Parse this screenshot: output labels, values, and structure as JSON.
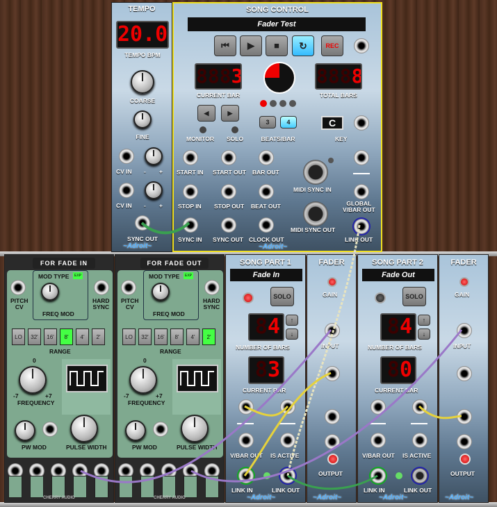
{
  "tempo": {
    "title": "TEMPO",
    "value_ghost": "8",
    "value": "20.0",
    "bpm_label": "TEMPO BPM",
    "coarse": "COARSE",
    "fine": "FINE",
    "cv_in": "CV IN",
    "minus": "-",
    "plus": "+",
    "sync_out": "SYNC OUT",
    "brand": "~Adroit~"
  },
  "song": {
    "title": "SONG CONTROL",
    "song_name": "Fader Test",
    "rec": "REC",
    "current_bar_ghost": "888",
    "current_bar": "3",
    "current_bar_label": "CURRENT BAR",
    "total_bars_ghost": "888",
    "total_bars": "8",
    "total_bars_label": "TOTAL BARS",
    "monitor": "MONITOR",
    "solo": "SOLO",
    "beats3": "3",
    "beats4": "4",
    "beats_label": "BEATS/BAR",
    "key": "C",
    "key_label": "KEY",
    "start_in": "START IN",
    "start_out": "START OUT",
    "bar_out": "BAR OUT",
    "midi_sync_in": "MIDI SYNC IN",
    "stop_in": "STOP IN",
    "stop_out": "STOP OUT",
    "beat_out": "BEAT OUT",
    "global_vbar": "GLOBAL\nV/BAR OUT",
    "sync_in": "SYNC IN",
    "sync_out": "SYNC OUT",
    "clock_out": "CLOCK OUT",
    "midi_sync_out": "MIDI SYNC OUT",
    "link_out": "LINK OUT",
    "brand": "~Adroit~"
  },
  "osc1": {
    "title": "FOR FADE IN",
    "mod_type": "MOD TYPE",
    "exp": "EXP",
    "pitch_cv": "PITCH\nCV",
    "hard_sync": "HARD\nSYNC",
    "freq_mod": "FREQ MOD",
    "ranges": [
      "LO",
      "32'",
      "16'",
      "8'",
      "4'",
      "2'"
    ],
    "range_selected": 3,
    "range_label": "RANGE",
    "zero": "0",
    "minus7": "-7",
    "plus7": "+7",
    "frequency": "FREQUENCY",
    "pw_mod": "PW MOD",
    "pulse_width": "PULSE WIDTH",
    "brand": "CHERRY AUDIO"
  },
  "osc2": {
    "title": "FOR FADE OUT",
    "mod_type": "MOD TYPE",
    "exp": "EXP",
    "pitch_cv": "PITCH\nCV",
    "hard_sync": "HARD\nSYNC",
    "freq_mod": "FREQ MOD",
    "ranges": [
      "LO",
      "32'",
      "16'",
      "8'",
      "4'",
      "2'"
    ],
    "range_selected": 5,
    "range_label": "RANGE",
    "zero": "0",
    "minus7": "-7",
    "plus7": "+7",
    "frequency": "FREQUENCY",
    "pw_mod": "PW MOD",
    "pulse_width": "PULSE WIDTH",
    "brand": "CHERRY AUDIO"
  },
  "part1": {
    "title": "SONG PART 1",
    "name": "Fade In",
    "solo": "SOLO",
    "bars_ghost": "8",
    "bars": "4",
    "bars_label": "NUMBER OF BARS",
    "cur_ghost": "8",
    "cur": "3",
    "cur_label": "CURRENT BAR",
    "vbar_out": "V/BAR OUT",
    "is_active": "IS ACTIVE",
    "link_in": "LINK IN",
    "link_out": "LINK OUT",
    "brand": "~Adroit~"
  },
  "fader1": {
    "title": "FADER",
    "gain": "GAIN",
    "input": "INPUT",
    "output": "OUTPUT",
    "brand": "~Adroit~"
  },
  "part2": {
    "title": "SONG PART 2",
    "name": "Fade Out",
    "solo": "SOLO",
    "bars_ghost": "8",
    "bars": "4",
    "bars_label": "NUMBER OF BARS",
    "cur_ghost": "8",
    "cur": "0",
    "cur_label": "CURRENT BAR",
    "vbar_out": "V/BAR OUT",
    "is_active": "IS ACTIVE",
    "link_in": "LINK IN",
    "link_out": "LINK OUT",
    "brand": "~Adroit~"
  },
  "fader2": {
    "title": "FADER",
    "gain": "GAIN",
    "input": "INPUT",
    "output": "OUTPUT",
    "brand": "~Adroit~"
  },
  "colors": {
    "led_red": "#e00000",
    "cable_green": "#3aa050",
    "cable_yellow": "#e6d23c",
    "cable_purple": "#9a78c8",
    "cable_cream": "#e8e4c0",
    "sky": "#a9c4da"
  }
}
